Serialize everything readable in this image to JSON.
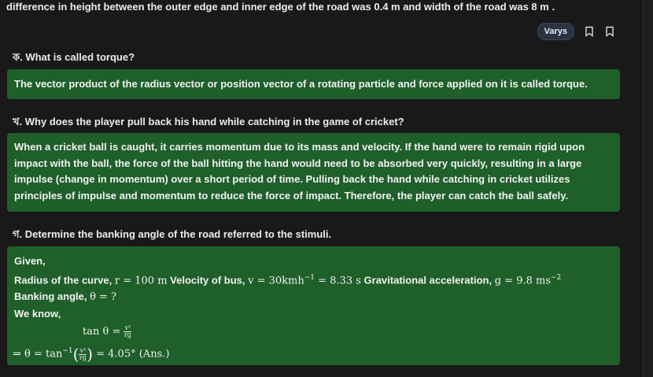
{
  "intro_text": "difference in height between the outer edge and inner edge of the road was 0.4 m and width of the road was 8 m .",
  "toolbar": {
    "badge": "Varys"
  },
  "q1": {
    "prefix": "ক.",
    "text": "What is called torque?"
  },
  "a1": "The vector product of the radius vector or position vector of a rotating particle and force applied on it is called torque.",
  "q2": {
    "prefix": "খ.",
    "text": "Why does the player pull back his hand while catching in the game of cricket?"
  },
  "a2": [
    "When a cricket ball is caught, it carries momentum due to its mass and velocity. If the hand were to remain rigid upon",
    "impact with the ball, the force of the ball hitting the hand would need to be absorbed very quickly, resulting in a large",
    "impulse (change in momentum) over a short period of time. Pulling back the hand while catching in cricket utilizes",
    "principles of impulse and momentum to reduce the force of impact. Therefore, the player can catch the ball safely."
  ],
  "q3": {
    "prefix": "গ.",
    "text": "Determine the banking angle of the road referred to the stimuli."
  },
  "a3": {
    "given": "Given,",
    "radius_label": "Radius of the curve, ",
    "radius_math": "r = 100 m",
    "velocity_label": " Velocity of bus, ",
    "velocity_math": "v = 30kmh",
    "velocity_exp": "−1",
    "velocity_conv": " = 8.33 s",
    "grav_label": " Gravitational acceleration, ",
    "grav_math": "g = 9.8 ms",
    "grav_exp": "−2",
    "bank_label": "Banking angle, ",
    "bank_math": "θ = ?",
    "we_know": "We know,",
    "eq1_lhs": "tan θ = ",
    "frac_num": "v²",
    "frac_den": "rg",
    "eq2_lhs": "⇒ θ = tan",
    "eq2_exp": "−1",
    "eq2_rhs": " = 4.05° (Ans.)"
  }
}
